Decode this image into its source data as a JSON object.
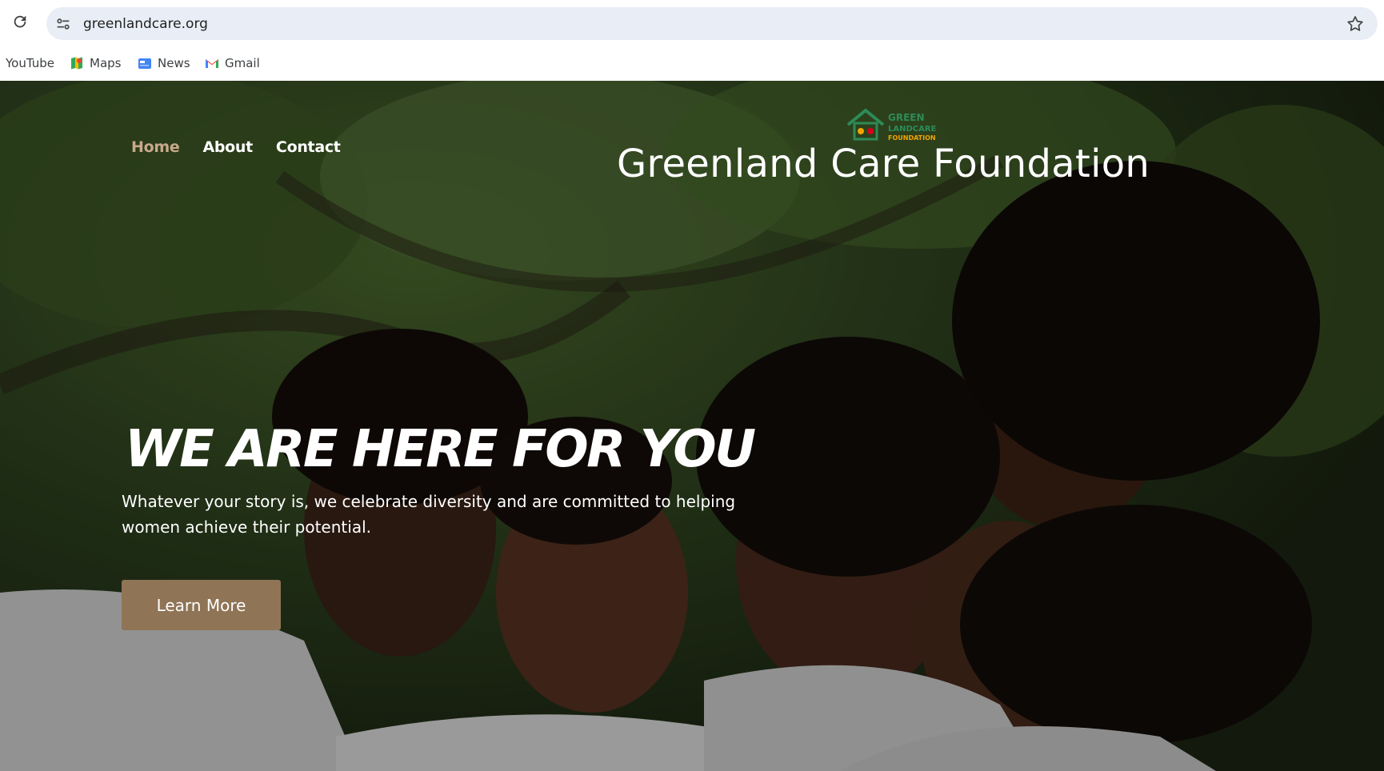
{
  "browser": {
    "url": "greenlandcare.org",
    "icons": {
      "reload": "reload-icon",
      "site_info": "site-info-icon",
      "bookmark_star": "star-icon"
    }
  },
  "bookmarks": [
    {
      "label": "YouTube",
      "icon": "youtube-icon"
    },
    {
      "label": "Maps",
      "icon": "maps-icon"
    },
    {
      "label": "News",
      "icon": "news-icon"
    },
    {
      "label": "Gmail",
      "icon": "gmail-icon"
    }
  ],
  "site": {
    "nav": {
      "home": "Home",
      "about": "About",
      "contact": "Contact"
    },
    "logo_text": [
      "GREEN",
      "LANDCARE",
      "FOUNDATION"
    ],
    "brand_name": "Greenland Care Foundation",
    "headline": "WE ARE HERE FOR YOU",
    "subtext": "Whatever your story is, we celebrate diversity and are committed to helping women achieve their potential.",
    "cta_label": "Learn More"
  },
  "colors": {
    "nav_active": "#c8a98a",
    "cta_background": "#8f7456",
    "omnibox": "#e9eef6"
  }
}
